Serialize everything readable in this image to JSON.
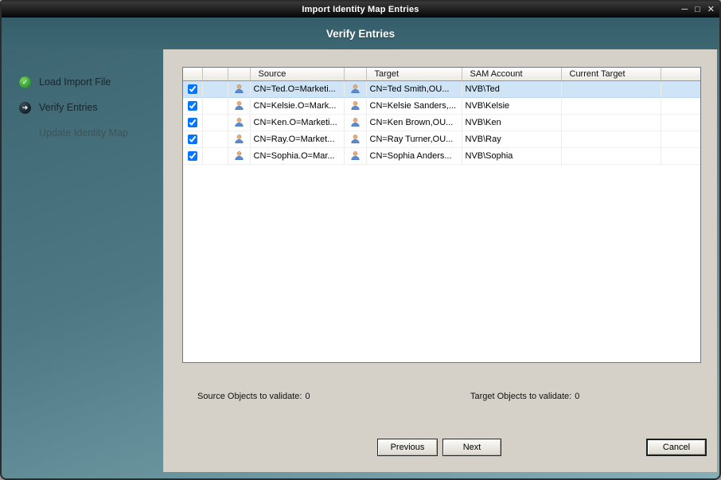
{
  "window": {
    "title": "Import Identity Map Entries"
  },
  "titlebar": {
    "minimize_glyph": "─",
    "maximize_glyph": "□",
    "close_glyph": "✕"
  },
  "header": {
    "title": "Verify Entries"
  },
  "sidebar": {
    "steps": [
      {
        "label": "Load Import File",
        "state": "complete",
        "icon": "check-icon",
        "glyph": "✓"
      },
      {
        "label": "Verify Entries",
        "state": "current",
        "icon": "arrow-icon",
        "glyph": "➜"
      },
      {
        "label": "Update Identity Map",
        "state": "pending",
        "icon": "",
        "glyph": ""
      }
    ]
  },
  "table": {
    "headers": [
      "",
      "",
      "",
      "Source",
      "",
      "Target",
      "SAM Account",
      "Current Target",
      ""
    ],
    "rows": [
      {
        "checked": true,
        "selected": true,
        "source": "CN=Ted.O=Marketi...",
        "target": "CN=Ted Smith,OU...",
        "sam_account": "NVB\\Ted",
        "current_target": ""
      },
      {
        "checked": true,
        "selected": false,
        "source": "CN=Kelsie.O=Mark...",
        "target": "CN=Kelsie Sanders,...",
        "sam_account": "NVB\\Kelsie",
        "current_target": ""
      },
      {
        "checked": true,
        "selected": false,
        "source": "CN=Ken.O=Marketi...",
        "target": "CN=Ken Brown,OU...",
        "sam_account": "NVB\\Ken",
        "current_target": ""
      },
      {
        "checked": true,
        "selected": false,
        "source": "CN=Ray.O=Market...",
        "target": "CN=Ray Turner,OU...",
        "sam_account": "NVB\\Ray",
        "current_target": ""
      },
      {
        "checked": true,
        "selected": false,
        "source": "CN=Sophia.O=Mar...",
        "target": "CN=Sophia Anders...",
        "sam_account": "NVB\\Sophia",
        "current_target": ""
      }
    ]
  },
  "status": {
    "source_label": "Source Objects to validate:",
    "source_value": "0",
    "target_label": "Target Objects to validate:",
    "target_value": "0"
  },
  "buttons": {
    "previous": "Previous",
    "next": "Next",
    "cancel": "Cancel"
  },
  "icons": {
    "row_user": "user-icon",
    "step_done": "check-icon",
    "step_current": "arrow-icon"
  },
  "colors": {
    "selection": "#cfe5f7",
    "complete_green": "#2f9a37",
    "band_teal": "#345d69"
  }
}
